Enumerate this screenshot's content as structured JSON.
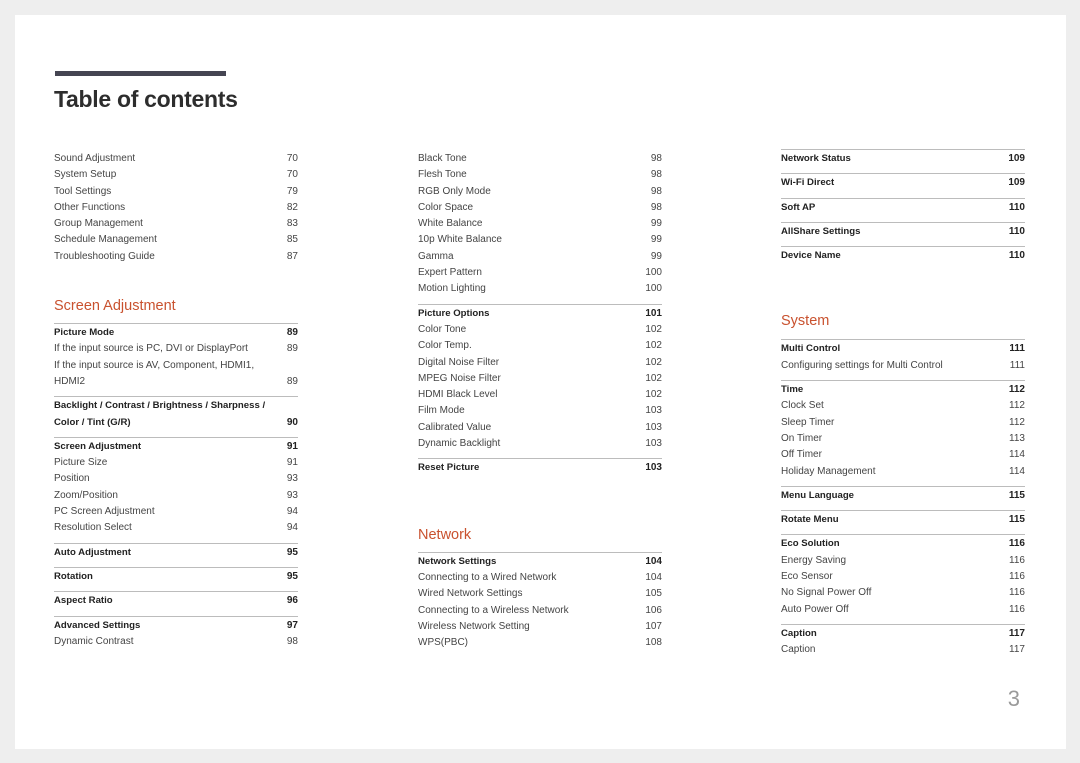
{
  "title": "Table of contents",
  "page_number": "3",
  "accent_color": "#c9522f",
  "columns": [
    {
      "blocks": [
        {
          "type": "group",
          "border": false,
          "rows": [
            {
              "label": "Sound Adjustment",
              "page": "70",
              "bold": false
            },
            {
              "label": "System Setup",
              "page": "70",
              "bold": false
            },
            {
              "label": "Tool Settings",
              "page": "79",
              "bold": false
            },
            {
              "label": "Other Functions",
              "page": "82",
              "bold": false
            },
            {
              "label": "Group Management",
              "page": "83",
              "bold": false
            },
            {
              "label": "Schedule Management",
              "page": "85",
              "bold": false
            },
            {
              "label": "Troubleshooting Guide",
              "page": "87",
              "bold": false
            }
          ]
        },
        {
          "type": "section",
          "title": "Screen Adjustment"
        },
        {
          "type": "group",
          "border": true,
          "rows": [
            {
              "label": "Picture Mode",
              "page": "89",
              "bold": true
            },
            {
              "label": "If the input source is PC, DVI or DisplayPort",
              "page": "89",
              "bold": false
            },
            {
              "label": "If the input source is AV, Component, HDMI1, HDMI2",
              "page": "89",
              "bold": false
            }
          ]
        },
        {
          "type": "group",
          "border": true,
          "rows": [
            {
              "label": "Backlight / Contrast / Brightness / Sharpness / Color / Tint (G/R)",
              "page": "90",
              "bold": true
            }
          ]
        },
        {
          "type": "group",
          "border": true,
          "rows": [
            {
              "label": "Screen Adjustment",
              "page": "91",
              "bold": true
            },
            {
              "label": "Picture Size",
              "page": "91",
              "bold": false
            },
            {
              "label": "Position",
              "page": "93",
              "bold": false
            },
            {
              "label": "Zoom/Position",
              "page": "93",
              "bold": false
            },
            {
              "label": "PC Screen Adjustment",
              "page": "94",
              "bold": false
            },
            {
              "label": "Resolution Select",
              "page": "94",
              "bold": false
            }
          ]
        },
        {
          "type": "group",
          "border": true,
          "rows": [
            {
              "label": "Auto Adjustment",
              "page": "95",
              "bold": true
            }
          ]
        },
        {
          "type": "group",
          "border": true,
          "rows": [
            {
              "label": "Rotation",
              "page": "95",
              "bold": true
            }
          ]
        },
        {
          "type": "group",
          "border": true,
          "rows": [
            {
              "label": "Aspect Ratio",
              "page": "96",
              "bold": true
            }
          ]
        },
        {
          "type": "group",
          "border": true,
          "rows": [
            {
              "label": "Advanced Settings",
              "page": "97",
              "bold": true
            },
            {
              "label": "Dynamic Contrast",
              "page": "98",
              "bold": false
            }
          ]
        }
      ]
    },
    {
      "blocks": [
        {
          "type": "group",
          "border": false,
          "rows": [
            {
              "label": "Black Tone",
              "page": "98",
              "bold": false
            },
            {
              "label": "Flesh Tone",
              "page": "98",
              "bold": false
            },
            {
              "label": "RGB Only Mode",
              "page": "98",
              "bold": false
            },
            {
              "label": "Color Space",
              "page": "98",
              "bold": false
            },
            {
              "label": "White Balance",
              "page": "99",
              "bold": false
            },
            {
              "label": "10p White Balance",
              "page": "99",
              "bold": false
            },
            {
              "label": "Gamma",
              "page": "99",
              "bold": false
            },
            {
              "label": "Expert Pattern",
              "page": "100",
              "bold": false
            },
            {
              "label": "Motion Lighting",
              "page": "100",
              "bold": false
            }
          ]
        },
        {
          "type": "group",
          "border": true,
          "rows": [
            {
              "label": "Picture Options",
              "page": "101",
              "bold": true
            },
            {
              "label": "Color Tone",
              "page": "102",
              "bold": false
            },
            {
              "label": "Color Temp.",
              "page": "102",
              "bold": false
            },
            {
              "label": "Digital Noise Filter",
              "page": "102",
              "bold": false
            },
            {
              "label": "MPEG Noise Filter",
              "page": "102",
              "bold": false
            },
            {
              "label": "HDMI Black Level",
              "page": "102",
              "bold": false
            },
            {
              "label": "Film Mode",
              "page": "103",
              "bold": false
            },
            {
              "label": "Calibrated Value",
              "page": "103",
              "bold": false
            },
            {
              "label": "Dynamic Backlight",
              "page": "103",
              "bold": false
            }
          ]
        },
        {
          "type": "group",
          "border": true,
          "rows": [
            {
              "label": "Reset Picture",
              "page": "103",
              "bold": true
            }
          ]
        },
        {
          "type": "section",
          "title": "Network"
        },
        {
          "type": "group",
          "border": true,
          "rows": [
            {
              "label": "Network Settings",
              "page": "104",
              "bold": true
            },
            {
              "label": "Connecting to a Wired Network",
              "page": "104",
              "bold": false
            },
            {
              "label": "Wired Network Settings",
              "page": "105",
              "bold": false
            },
            {
              "label": "Connecting to a Wireless Network",
              "page": "106",
              "bold": false
            },
            {
              "label": "Wireless Network Setting",
              "page": "107",
              "bold": false
            },
            {
              "label": "WPS(PBC)",
              "page": "108",
              "bold": false
            }
          ]
        }
      ]
    },
    {
      "blocks": [
        {
          "type": "group",
          "border": true,
          "rows": [
            {
              "label": "Network Status",
              "page": "109",
              "bold": true
            }
          ]
        },
        {
          "type": "group",
          "border": true,
          "rows": [
            {
              "label": "Wi-Fi Direct",
              "page": "109",
              "bold": true
            }
          ]
        },
        {
          "type": "group",
          "border": true,
          "rows": [
            {
              "label": "Soft AP",
              "page": "110",
              "bold": true
            }
          ]
        },
        {
          "type": "group",
          "border": true,
          "rows": [
            {
              "label": "AllShare Settings",
              "page": "110",
              "bold": true
            }
          ]
        },
        {
          "type": "group",
          "border": true,
          "rows": [
            {
              "label": "Device Name",
              "page": "110",
              "bold": true
            }
          ]
        },
        {
          "type": "section",
          "title": "System"
        },
        {
          "type": "group",
          "border": true,
          "rows": [
            {
              "label": "Multi Control",
              "page": "111",
              "bold": true
            },
            {
              "label": "Configuring settings for Multi Control",
              "page": "111",
              "bold": false
            }
          ]
        },
        {
          "type": "group",
          "border": true,
          "rows": [
            {
              "label": "Time",
              "page": "112",
              "bold": true
            },
            {
              "label": "Clock Set",
              "page": "112",
              "bold": false
            },
            {
              "label": "Sleep Timer",
              "page": "112",
              "bold": false
            },
            {
              "label": "On Timer",
              "page": "113",
              "bold": false
            },
            {
              "label": "Off Timer",
              "page": "114",
              "bold": false
            },
            {
              "label": "Holiday Management",
              "page": "114",
              "bold": false
            }
          ]
        },
        {
          "type": "group",
          "border": true,
          "rows": [
            {
              "label": "Menu Language",
              "page": "115",
              "bold": true
            }
          ]
        },
        {
          "type": "group",
          "border": true,
          "rows": [
            {
              "label": "Rotate Menu",
              "page": "115",
              "bold": true
            }
          ]
        },
        {
          "type": "group",
          "border": true,
          "rows": [
            {
              "label": "Eco Solution",
              "page": "116",
              "bold": true
            },
            {
              "label": "Energy Saving",
              "page": "116",
              "bold": false
            },
            {
              "label": "Eco Sensor",
              "page": "116",
              "bold": false
            },
            {
              "label": "No Signal Power Off",
              "page": "116",
              "bold": false
            },
            {
              "label": "Auto Power Off",
              "page": "116",
              "bold": false
            }
          ]
        },
        {
          "type": "group",
          "border": true,
          "rows": [
            {
              "label": "Caption",
              "page": "117",
              "bold": true
            },
            {
              "label": "Caption",
              "page": "117",
              "bold": false
            }
          ]
        }
      ]
    }
  ]
}
